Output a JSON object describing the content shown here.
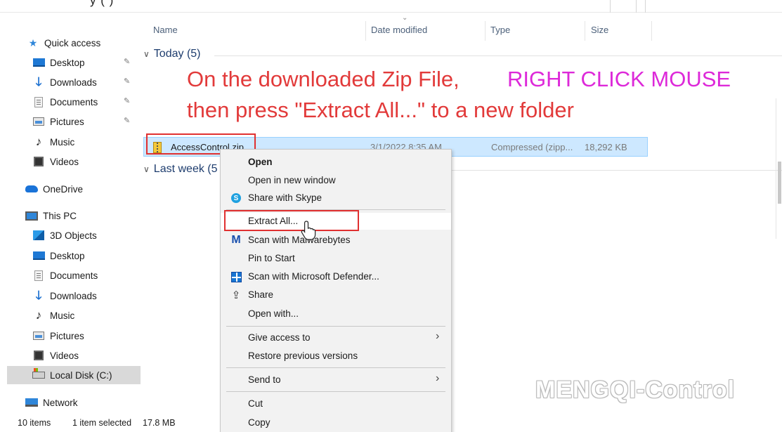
{
  "top_fragment": "y (            ) ",
  "nav": {
    "quick_access": "Quick access",
    "qa_items": [
      {
        "label": "Desktop",
        "icon": "desktop-icon",
        "pinned": true
      },
      {
        "label": "Downloads",
        "icon": "downloads-icon",
        "pinned": true
      },
      {
        "label": "Documents",
        "icon": "documents-icon",
        "pinned": true
      },
      {
        "label": "Pictures",
        "icon": "pictures-icon",
        "pinned": true
      },
      {
        "label": "Music",
        "icon": "music-icon",
        "pinned": false
      },
      {
        "label": "Videos",
        "icon": "videos-icon",
        "pinned": false
      }
    ],
    "onedrive": "OneDrive",
    "this_pc": "This PC",
    "pc_items": [
      {
        "label": "3D Objects",
        "icon": "3d-objects-icon"
      },
      {
        "label": "Desktop",
        "icon": "desktop-icon"
      },
      {
        "label": "Documents",
        "icon": "documents-icon"
      },
      {
        "label": "Downloads",
        "icon": "downloads-icon"
      },
      {
        "label": "Music",
        "icon": "music-icon"
      },
      {
        "label": "Pictures",
        "icon": "pictures-icon"
      },
      {
        "label": "Videos",
        "icon": "videos-icon"
      },
      {
        "label": "Local Disk (C:)",
        "icon": "local-disk-icon",
        "selected": true
      }
    ],
    "network": "Network",
    "pin_glyph": "📌"
  },
  "columns": {
    "name": "Name",
    "date_modified": "Date modified",
    "type": "Type",
    "size": "Size"
  },
  "groups": {
    "today": "Today (5)",
    "last_week": "Last week (5"
  },
  "annotation": {
    "line1_red": "On the downloaded Zip File,",
    "line1_magenta": "RIGHT CLICK MOUSE",
    "line2_red": "then press \"Extract All...\" to a new folder",
    "color_red": "#e23a3a",
    "color_magenta": "#dd29d9"
  },
  "file": {
    "name": "AccessControl.zip",
    "date": "3/1/2022 8:35 AM",
    "type": "Compressed (zipp...",
    "size": "18,292 KB"
  },
  "context_menu": {
    "items": {
      "open": "Open",
      "open_new_window": "Open in new window",
      "share_skype": "Share with Skype",
      "extract_all": "Extract All...",
      "scan_malwarebytes": "Scan with Malwarebytes",
      "pin_to_start": "Pin to Start",
      "scan_defender": "Scan with Microsoft Defender...",
      "share": "Share",
      "open_with": "Open with...",
      "give_access": "Give access to",
      "restore_versions": "Restore previous versions",
      "send_to": "Send to",
      "cut": "Cut",
      "copy": "Copy"
    },
    "submenu_glyph": "›"
  },
  "watermark": "MENGQI-Control",
  "status": {
    "items": "10 items",
    "selected": "1 item selected",
    "size": "17.8 MB"
  },
  "colors": {
    "selection_bg": "#cde8ff",
    "highlight_box": "#e03030",
    "menu_bg": "#f2f2f2"
  }
}
